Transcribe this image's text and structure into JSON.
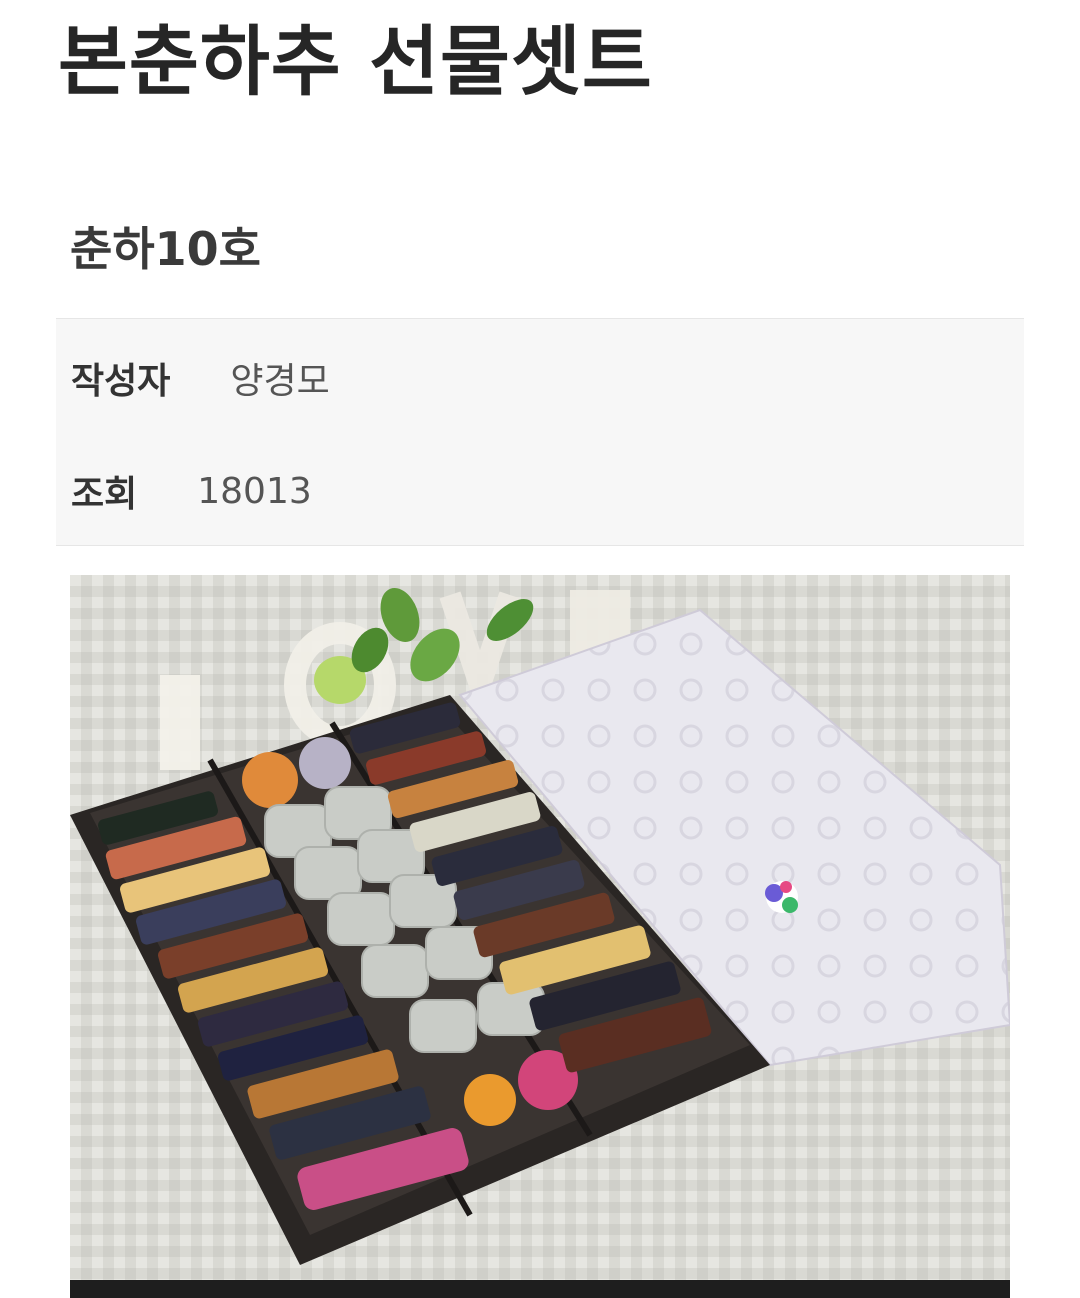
{
  "page": {
    "title": "본춘하추 선물셋트"
  },
  "post": {
    "title": "춘하10호",
    "author_label": "작성자",
    "author_value": "양경모",
    "views_label": "조회",
    "views_value": "18013"
  },
  "image": {
    "description_icon": "product-photo"
  }
}
